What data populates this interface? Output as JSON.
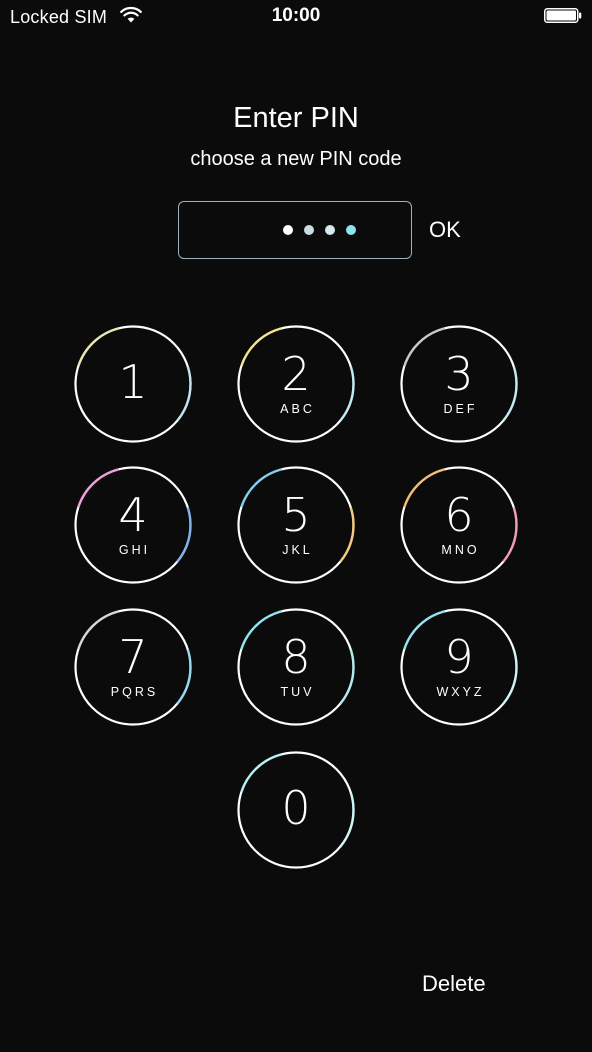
{
  "status_bar": {
    "carrier": "Locked SIM",
    "time": "10:00",
    "wifi_icon": "wifi-icon",
    "battery_icon": "battery-full-icon",
    "battery_level": 1.0
  },
  "title": "Enter PIN",
  "subtitle": "choose a new PIN code",
  "pin": {
    "entered_count": 4,
    "dot_colors": [
      "#ffffff",
      "#c9dde3",
      "#d6e9ef",
      "#8fe3ee"
    ],
    "ok_label": "OK"
  },
  "keypad": {
    "keys": [
      {
        "digit": "1",
        "letters": "",
        "accent": [
          "#e8e4a8",
          "#b8e0f0"
        ]
      },
      {
        "digit": "2",
        "letters": "ABC",
        "accent": [
          "#f3e27a",
          "#b5e9f5"
        ]
      },
      {
        "digit": "3",
        "letters": "DEF",
        "accent": [
          "#bfbfbf",
          "#b8e8f0"
        ]
      },
      {
        "digit": "4",
        "letters": "GHI",
        "accent": [
          "#ef8fd8",
          "#6fa4e8"
        ]
      },
      {
        "digit": "5",
        "letters": "JKL",
        "accent": [
          "#71c6ee",
          "#f2c36b"
        ]
      },
      {
        "digit": "6",
        "letters": "MNO",
        "accent": [
          "#f5b25a",
          "#f08bb0"
        ]
      },
      {
        "digit": "7",
        "letters": "PQRS",
        "accent": [
          "#d0d0d0",
          "#84d3ee"
        ]
      },
      {
        "digit": "8",
        "letters": "TUV",
        "accent": [
          "#7fe0f0",
          "#a7e6ee"
        ]
      },
      {
        "digit": "9",
        "letters": "WXYZ",
        "accent": [
          "#7fdff0",
          "#c9f0f5"
        ]
      },
      {
        "digit": "0",
        "letters": "",
        "accent": [
          "#a8f0f5",
          "#c8f5f8"
        ]
      }
    ]
  },
  "delete_label": "Delete",
  "colors": {
    "background": "#0b0b0b",
    "text": "#ffffff",
    "pin_border": "#9fb2bb"
  }
}
